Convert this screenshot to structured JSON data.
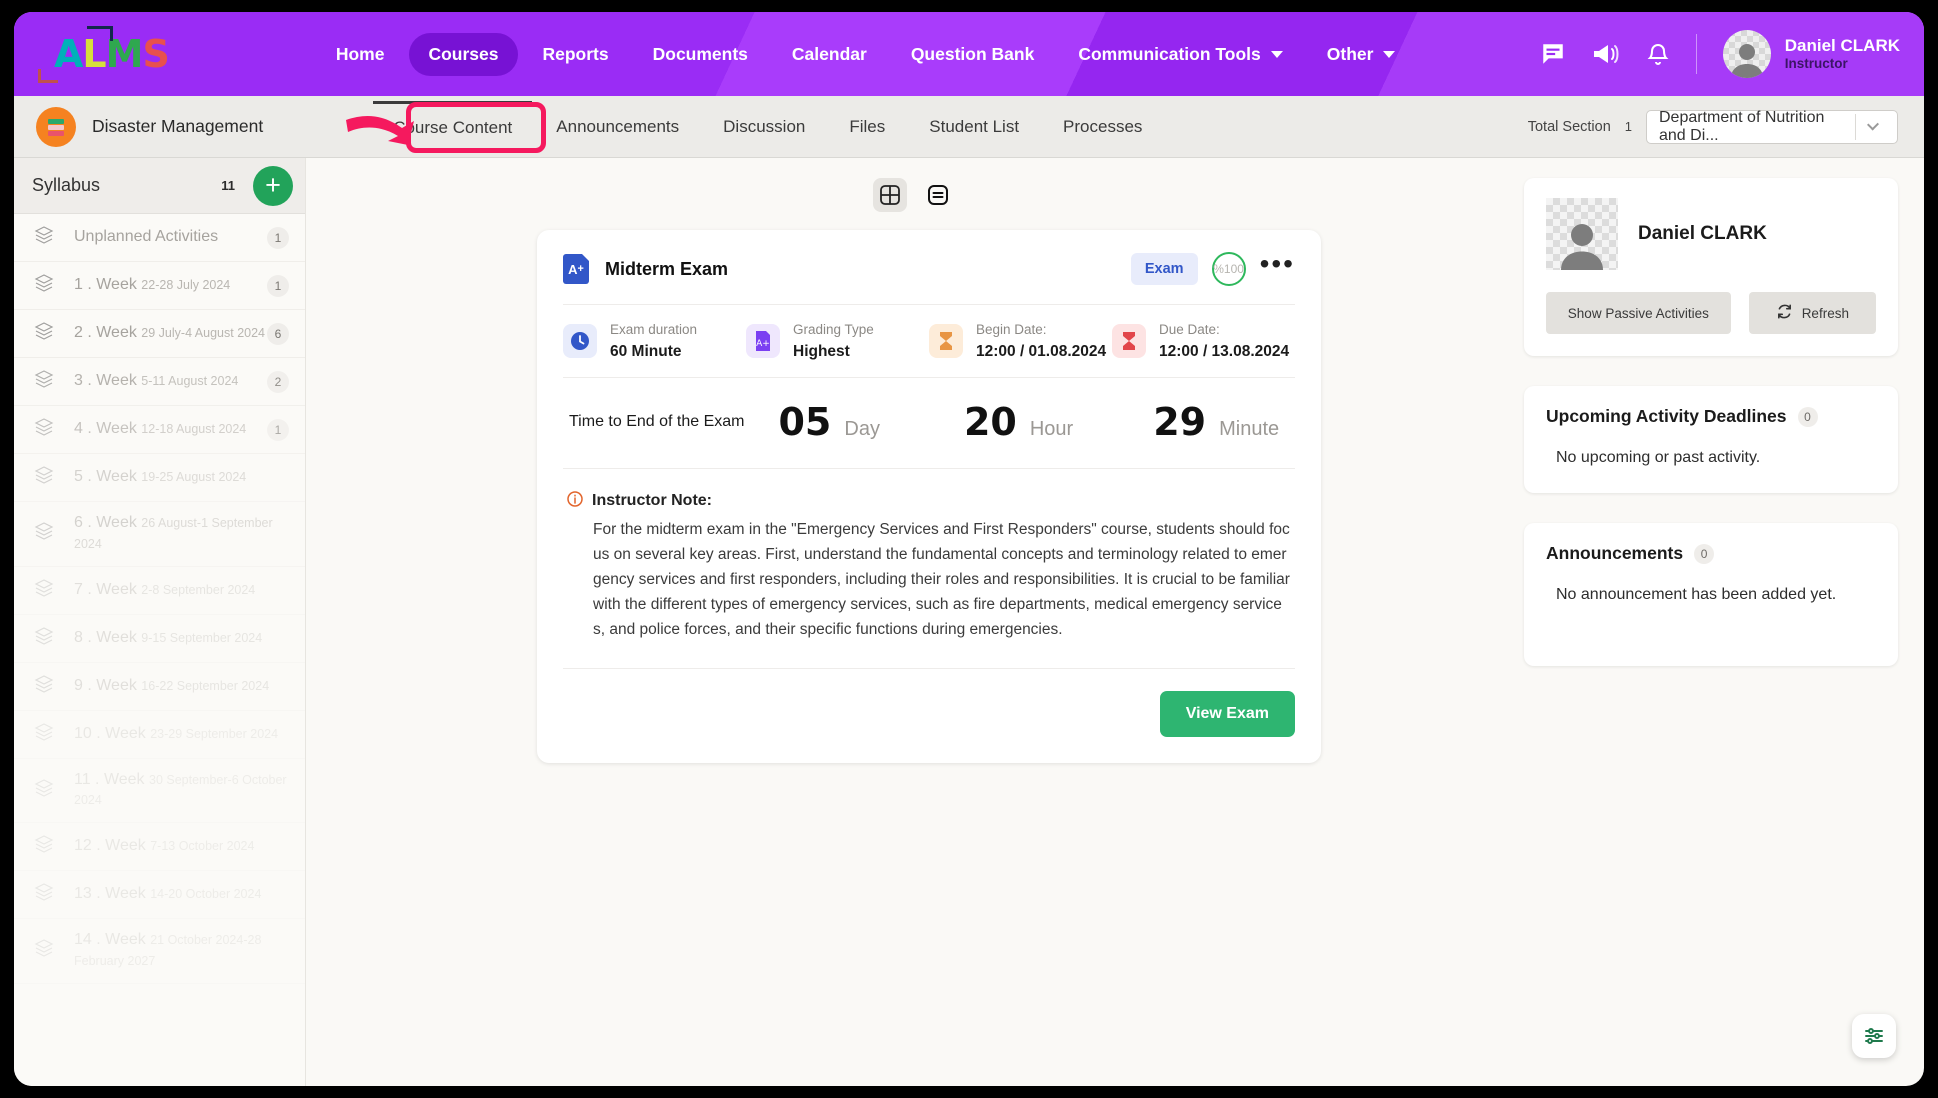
{
  "brand": {
    "logo_text": "ALMS",
    "logo_letters": [
      "A",
      "L",
      "M",
      "S"
    ],
    "accent": "#9a2cf5"
  },
  "topnav": {
    "items": [
      {
        "label": "Home",
        "active": false,
        "has_caret": false
      },
      {
        "label": "Courses",
        "active": true,
        "has_caret": false
      },
      {
        "label": "Reports",
        "active": false,
        "has_caret": false
      },
      {
        "label": "Documents",
        "active": false,
        "has_caret": false
      },
      {
        "label": "Calendar",
        "active": false,
        "has_caret": false
      },
      {
        "label": "Question Bank",
        "active": false,
        "has_caret": false
      },
      {
        "label": "Communication Tools",
        "active": false,
        "has_caret": true
      },
      {
        "label": "Other",
        "active": false,
        "has_caret": true
      }
    ],
    "icons": [
      "message-icon",
      "megaphone-icon",
      "bell-icon"
    ],
    "user": {
      "name": "Daniel CLARK",
      "role": "Instructor"
    }
  },
  "coursebar": {
    "course_title": "Disaster Management",
    "tabs": [
      {
        "label": "Course Content",
        "active": true,
        "highlighted": true
      },
      {
        "label": "Announcements",
        "active": false,
        "highlighted": false
      },
      {
        "label": "Discussion",
        "active": false,
        "highlighted": false
      },
      {
        "label": "Files",
        "active": false,
        "highlighted": false
      },
      {
        "label": "Student List",
        "active": false,
        "highlighted": false
      },
      {
        "label": "Processes",
        "active": false,
        "highlighted": false
      }
    ],
    "total_section_label": "Total Section",
    "total_section_count": "1",
    "section_select_value": "Department of Nutrition and Di..."
  },
  "sidebar": {
    "header_title": "Syllabus",
    "header_count": "11",
    "add_label": "+",
    "weeks": [
      {
        "name": "Unplanned Activities",
        "date": "",
        "count": "1"
      },
      {
        "name": "1 . Week",
        "date": "22-28 July 2024",
        "count": "1"
      },
      {
        "name": "2 . Week",
        "date": "29 July-4 August 2024",
        "count": "6"
      },
      {
        "name": "3 . Week",
        "date": "5-11 August 2024",
        "count": "2"
      },
      {
        "name": "4 . Week",
        "date": "12-18 August 2024",
        "count": "1"
      },
      {
        "name": "5 . Week",
        "date": "19-25 August 2024",
        "count": ""
      },
      {
        "name": "6 . Week",
        "date": "26 August-1 September 2024",
        "count": ""
      },
      {
        "name": "7 . Week",
        "date": "2-8 September 2024",
        "count": ""
      },
      {
        "name": "8 . Week",
        "date": "9-15 September 2024",
        "count": ""
      },
      {
        "name": "9 . Week",
        "date": "16-22 September 2024",
        "count": ""
      },
      {
        "name": "10 . Week",
        "date": "23-29 September 2024",
        "count": ""
      },
      {
        "name": "11 . Week",
        "date": "30 September-6 October 2024",
        "count": ""
      },
      {
        "name": "12 . Week",
        "date": "7-13 October 2024",
        "count": ""
      },
      {
        "name": "13 . Week",
        "date": "14-20 October 2024",
        "count": ""
      },
      {
        "name": "14 . Week",
        "date": "21 October 2024-28 February 2027",
        "count": ""
      }
    ]
  },
  "main": {
    "view_toggle": [
      "grid-view-icon",
      "list-view-icon"
    ],
    "card": {
      "title": "Midterm Exam",
      "type_badge": "Exam",
      "weight_badge": "%100",
      "more_label": "•••",
      "info": [
        {
          "icon": "clock-icon",
          "label": "Exam duration",
          "value": "60 Minute"
        },
        {
          "icon": "grade-icon",
          "label": "Grading Type",
          "value": "Highest"
        },
        {
          "icon": "hourglass-start-icon",
          "label": "Begin Date:",
          "value": "12:00 / 01.08.2024"
        },
        {
          "icon": "hourglass-end-icon",
          "label": "Due Date:",
          "value": "12:00 / 13.08.2024"
        }
      ],
      "countdown_label": "Time to End of the Exam",
      "countdown": [
        {
          "value": "05",
          "unit": "Day"
        },
        {
          "value": "20",
          "unit": "Hour"
        },
        {
          "value": "29",
          "unit": "Minute"
        }
      ],
      "note_title": "Instructor Note:",
      "note_body": "For the midterm exam in the \"Emergency Services and First Responders\" course, students should focus on several key areas. First, understand the fundamental concepts and terminology related to emergency services and first responders, including their roles and responsibilities. It is crucial to be familiar with the different types of emergency services, such as fire departments, medical emergency services, and police forces, and their specific functions during emergencies.",
      "action_label": "View Exam"
    }
  },
  "rightpanel": {
    "profile": {
      "name": "Daniel CLARK",
      "btn_passive": "Show Passive Activities",
      "btn_refresh": "Refresh"
    },
    "deadlines": {
      "title": "Upcoming Activity Deadlines",
      "count": "0",
      "empty": "No upcoming or past activity."
    },
    "announcements": {
      "title": "Announcements",
      "count": "0",
      "empty": "No announcement has been added yet."
    }
  },
  "fab": {
    "name": "settings-sliders-icon"
  }
}
